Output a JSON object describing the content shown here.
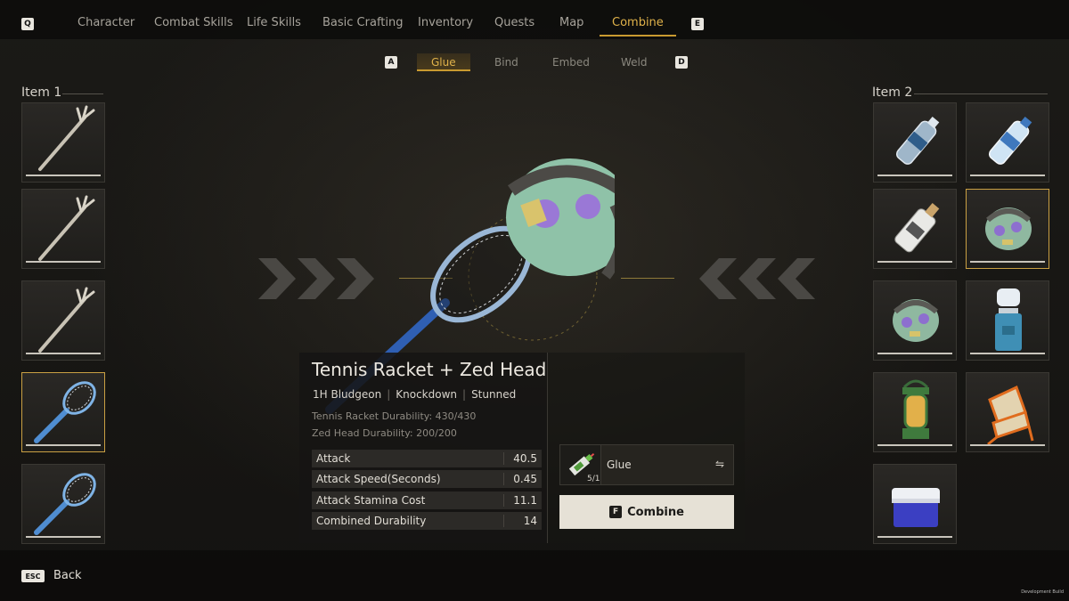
{
  "nav": {
    "prev_key": "Q",
    "next_key": "E",
    "tabs": [
      {
        "label": "Character"
      },
      {
        "label": "Combat Skills"
      },
      {
        "label": "Life Skills"
      },
      {
        "label": "Basic Crafting"
      },
      {
        "label": "Inventory"
      },
      {
        "label": "Quests"
      },
      {
        "label": "Map"
      },
      {
        "label": "Combine",
        "active": true
      }
    ]
  },
  "subnav": {
    "prev_key": "A",
    "next_key": "D",
    "tabs": [
      {
        "label": "Glue",
        "active": true
      },
      {
        "label": "Bind"
      },
      {
        "label": "Embed"
      },
      {
        "label": "Weld"
      }
    ]
  },
  "item1": {
    "title": "Item 1",
    "slots": [
      {
        "icon": "pitchfork-icon"
      },
      {
        "icon": "pitchfork-icon"
      },
      {
        "icon": "pitchfork-icon"
      },
      {
        "icon": "tennis-racket-icon",
        "selected": true
      },
      {
        "icon": "tennis-racket-icon"
      }
    ]
  },
  "item2": {
    "title": "Item 2",
    "slots": [
      {
        "icon": "water-bottle-icon"
      },
      {
        "icon": "water-bottle-icon"
      },
      {
        "icon": "white-bottle-icon"
      },
      {
        "icon": "zed-head-icon",
        "selected": true
      },
      {
        "icon": "zed-head-icon"
      },
      {
        "icon": "water-cooler-icon"
      },
      {
        "icon": "lantern-icon"
      },
      {
        "icon": "folding-chair-icon"
      },
      {
        "icon": "cooler-box-icon"
      }
    ]
  },
  "result": {
    "title": "Tennis Racket + Zed Head",
    "tags": [
      "1H Bludgeon",
      "Knockdown",
      "Stunned"
    ],
    "durability_lines": [
      "Tennis Racket Durability: 430/430",
      "Zed Head Durability: 200/200"
    ],
    "stats": [
      {
        "label": "Attack",
        "value": "40.5"
      },
      {
        "label": "Attack Speed(Seconds)",
        "value": "0.45"
      },
      {
        "label": "Attack Stamina Cost",
        "value": "11.1"
      },
      {
        "label": "Combined Durability",
        "value": "14"
      }
    ]
  },
  "material": {
    "icon": "glue-tube-icon",
    "name": "Glue",
    "count": "5/1",
    "swap_icon": "swap-icon",
    "swap_glyph": "⇋"
  },
  "combine": {
    "key": "F",
    "label": "Combine"
  },
  "footer": {
    "esc_key": "ESC",
    "back_label": "Back",
    "build_label": "Development Build"
  },
  "colors": {
    "accent": "#e0b24a",
    "selected_border": "#caa043"
  }
}
